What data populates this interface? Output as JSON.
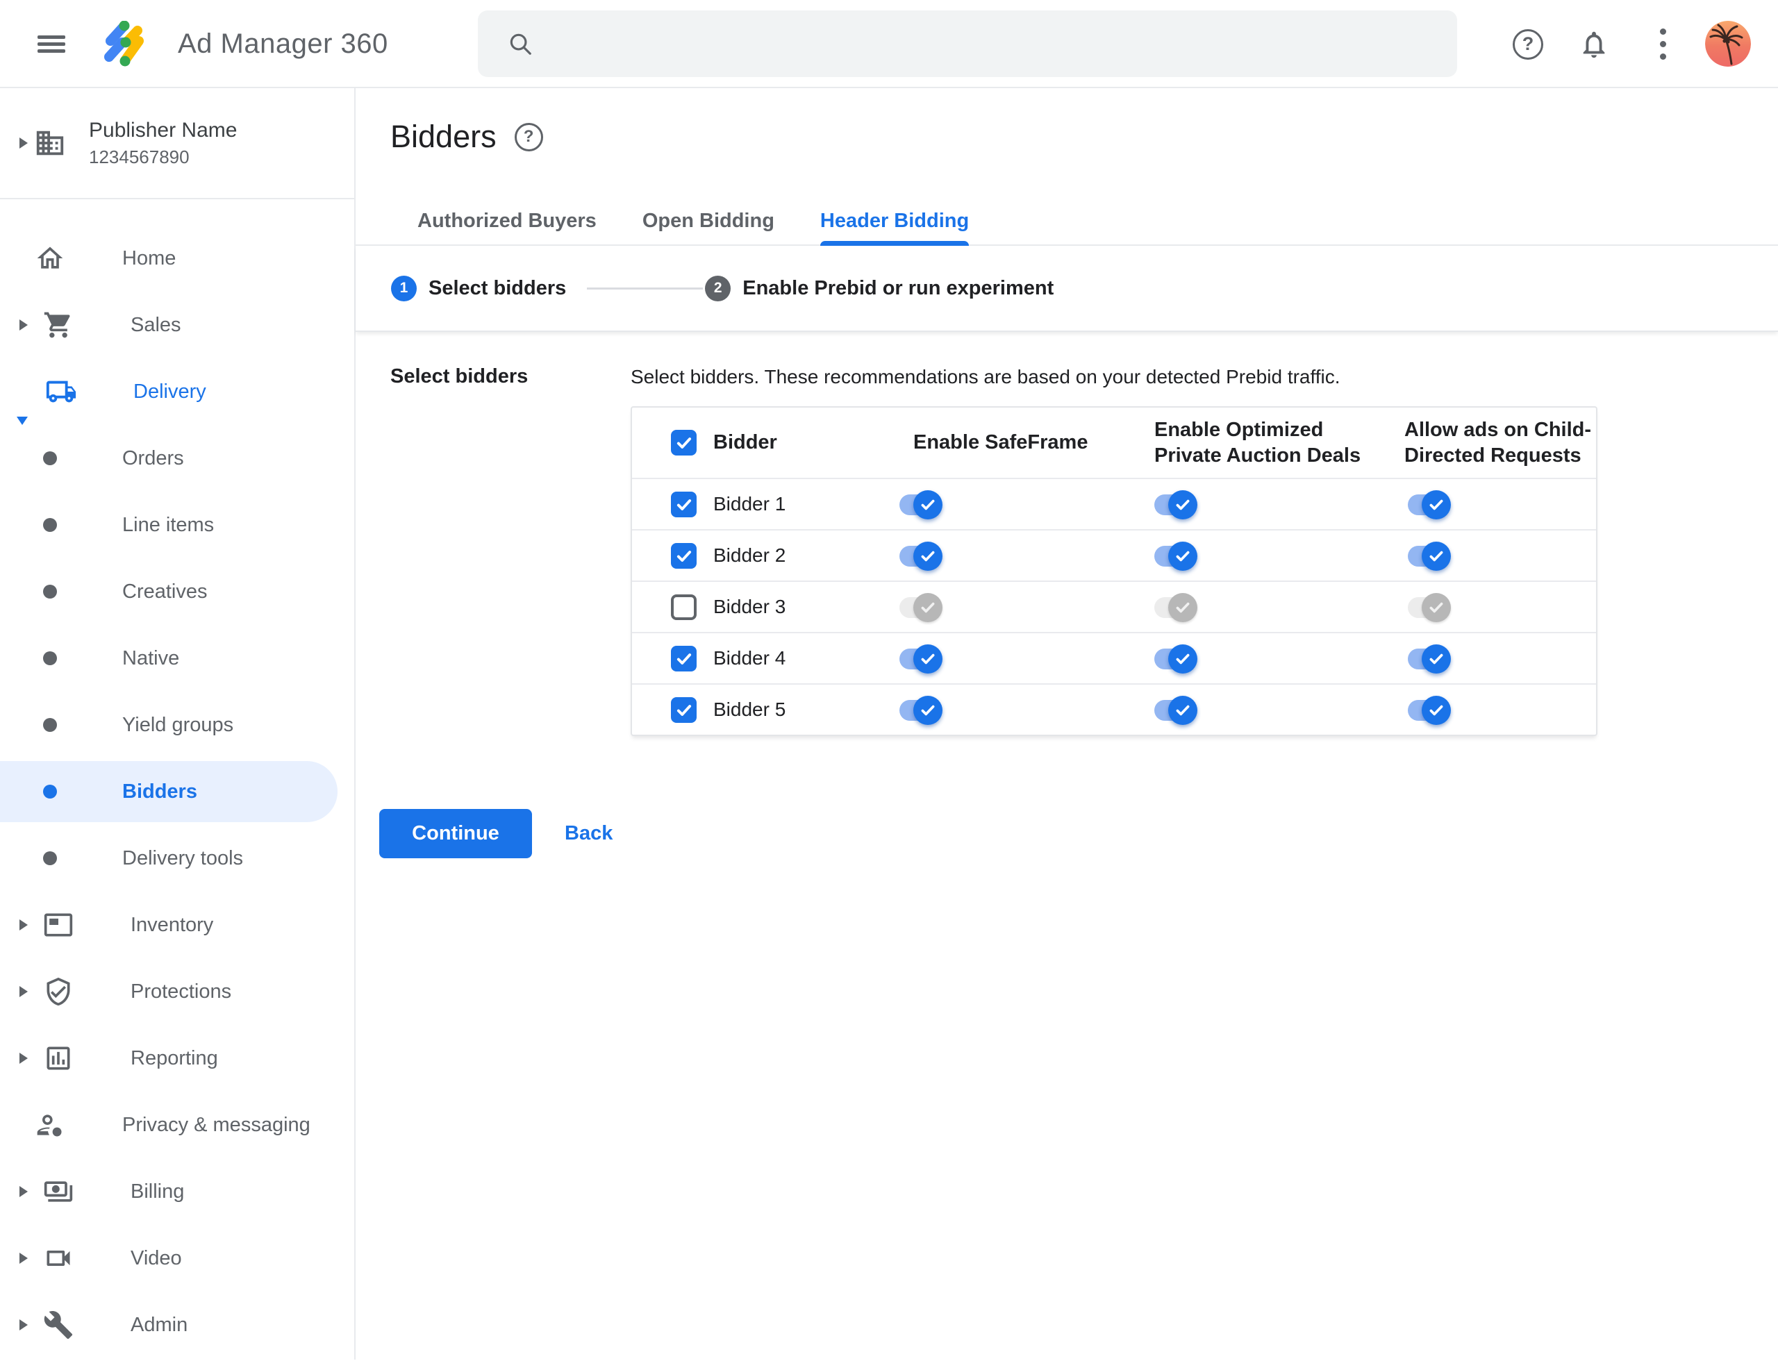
{
  "header": {
    "app_title": "Ad Manager 360",
    "menu_icon": "hamburger-icon",
    "logo_icon": "ad-manager-logo",
    "search": {
      "placeholder": "",
      "value": "",
      "icon": "search-icon"
    },
    "action_icons": [
      "help-icon",
      "notifications-bell-icon",
      "more-vertical-icon",
      "avatar-palm-tree"
    ]
  },
  "sidebar": {
    "publisher": {
      "name": "Publisher Name",
      "id": "1234567890",
      "icon": "building-icon"
    },
    "items": [
      {
        "label": "Home",
        "icon": "home-icon",
        "type": "top",
        "caret": false
      },
      {
        "label": "Sales",
        "icon": "cart-icon",
        "type": "top",
        "caret": true
      },
      {
        "label": "Delivery",
        "icon": "truck-icon",
        "type": "top",
        "caret": true,
        "expanded": true,
        "highlighted": true
      },
      {
        "label": "Orders",
        "icon": "bullet",
        "type": "sub"
      },
      {
        "label": "Line items",
        "icon": "bullet",
        "type": "sub"
      },
      {
        "label": "Creatives",
        "icon": "bullet",
        "type": "sub"
      },
      {
        "label": "Native",
        "icon": "bullet",
        "type": "sub"
      },
      {
        "label": "Yield groups",
        "icon": "bullet",
        "type": "sub"
      },
      {
        "label": "Bidders",
        "icon": "bullet",
        "type": "sub",
        "active": true
      },
      {
        "label": "Delivery tools",
        "icon": "bullet",
        "type": "sub"
      },
      {
        "label": "Inventory",
        "icon": "inventory-icon",
        "type": "top",
        "caret": true
      },
      {
        "label": "Protections",
        "icon": "shield-check-icon",
        "type": "top",
        "caret": true
      },
      {
        "label": "Reporting",
        "icon": "bar-chart-icon",
        "type": "top",
        "caret": true
      },
      {
        "label": "Privacy & messaging",
        "icon": "person-badge-icon",
        "type": "top",
        "caret": false
      },
      {
        "label": "Billing",
        "icon": "banknote-icon",
        "type": "top",
        "caret": true
      },
      {
        "label": "Video",
        "icon": "videocam-icon",
        "type": "top",
        "caret": true
      },
      {
        "label": "Admin",
        "icon": "wrench-icon",
        "type": "top",
        "caret": true
      }
    ]
  },
  "main": {
    "page_title": "Bidders",
    "page_help_icon": "help-icon",
    "tabs": [
      {
        "label": "Authorized Buyers",
        "active": false
      },
      {
        "label": "Open Bidding",
        "active": false
      },
      {
        "label": "Header Bidding",
        "active": true
      }
    ],
    "stepper": [
      {
        "number": "1",
        "label": "Select bidders",
        "state": "active"
      },
      {
        "number": "2",
        "label": "Enable Prebid or run experiment",
        "state": "upcoming"
      }
    ],
    "section_label": "Select bidders",
    "description": "Select bidders. These recommendations are based on your detected Prebid traffic.",
    "table": {
      "select_all_checked": true,
      "columns": [
        "Bidder",
        "Enable SafeFrame",
        "Enable Optimized Private Auction Deals",
        "Allow ads on Child-Directed Requests"
      ],
      "rows": [
        {
          "name": "Bidder 1",
          "checked": true,
          "enable_safeframe": true,
          "enable_optimized_private_auction_deals": true,
          "allow_ads_on_child_directed_requests": true
        },
        {
          "name": "Bidder 2",
          "checked": true,
          "enable_safeframe": true,
          "enable_optimized_private_auction_deals": true,
          "allow_ads_on_child_directed_requests": true
        },
        {
          "name": "Bidder 3",
          "checked": false,
          "enable_safeframe": false,
          "enable_optimized_private_auction_deals": false,
          "allow_ads_on_child_directed_requests": false
        },
        {
          "name": "Bidder 4",
          "checked": true,
          "enable_safeframe": true,
          "enable_optimized_private_auction_deals": true,
          "allow_ads_on_child_directed_requests": true
        },
        {
          "name": "Bidder 5",
          "checked": true,
          "enable_safeframe": true,
          "enable_optimized_private_auction_deals": true,
          "allow_ads_on_child_directed_requests": true
        }
      ]
    },
    "actions": {
      "continue": "Continue",
      "back": "Back"
    }
  },
  "colors": {
    "accent": "#1a73e8",
    "text_primary": "#202124",
    "text_secondary": "#5f6368",
    "border": "#e8eaed",
    "active_item_bg": "#e8f0fe",
    "search_bg": "#f1f3f4",
    "toggle_track_on": "#93b6f2",
    "toggle_track_off": "#ececec",
    "toggle_thumb_off": "#b7b7b7",
    "step_inactive": "#5f6368",
    "logo_blue": "#4285f4",
    "logo_yellow": "#fbbc04",
    "logo_green": "#34a853"
  }
}
